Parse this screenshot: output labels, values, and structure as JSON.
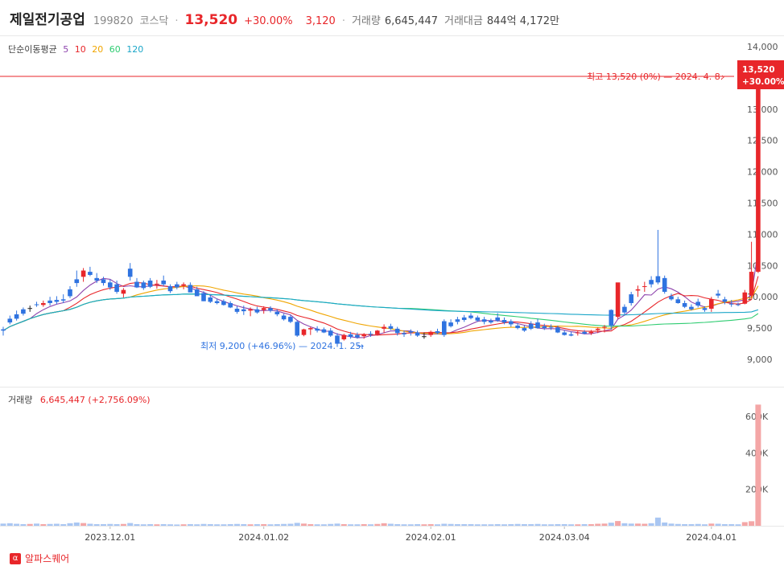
{
  "header": {
    "name": "제일전기공업",
    "code": "199820",
    "market": "코스닥",
    "price": "13,520",
    "change_pct": "+30.00%",
    "change_abs": "3,120",
    "volume_label": "거래량",
    "volume": "6,645,447",
    "amount_label": "거래대금",
    "amount": "844억 4,172만"
  },
  "legend": {
    "title": "단순이동평균",
    "periods": [
      {
        "label": "5",
        "color": "#8e44ad"
      },
      {
        "label": "10",
        "color": "#e8262a"
      },
      {
        "label": "20",
        "color": "#f0a500"
      },
      {
        "label": "60",
        "color": "#2ecc71"
      },
      {
        "label": "120",
        "color": "#1aa6c8"
      }
    ]
  },
  "volume_legend": {
    "label": "거래량",
    "value": "6,645,447",
    "change": "(+2,756.09%)"
  },
  "annotations": {
    "high": "최고 13,520 (0%) — 2024. 4. 8.",
    "low": "최저 9,200 (+46.96%) — 2024. 1. 25.",
    "price_box_price": "13,520",
    "price_box_pct": "+30.00%"
  },
  "footer": {
    "brand": "알파스퀘어",
    "logo_char": "α"
  },
  "colors": {
    "up": "#e8262a",
    "down": "#2f73e0",
    "flat": "#222222",
    "vol_up": "#f4a6a6",
    "vol_down": "#a9c6f2"
  },
  "chart_data": {
    "type": "candlestick",
    "price_axis": {
      "min": 8600,
      "max": 14200,
      "ticks": [
        "14,000",
        "13,500",
        "13,000",
        "12,500",
        "12,000",
        "11,500",
        "11,000",
        "10,500",
        "10,000",
        "9,500",
        "9,000"
      ],
      "tick_values": [
        14000,
        13500,
        13000,
        12500,
        12000,
        11500,
        11000,
        10500,
        10000,
        9500,
        9000
      ]
    },
    "volume_axis": {
      "min": 0,
      "max": 700000,
      "ticks": [
        "600K",
        "400K",
        "200K"
      ],
      "tick_values": [
        600000,
        400000,
        200000
      ]
    },
    "x_ticks": [
      "2023.12.01",
      "2024.01.02",
      "2024.02.01",
      "2024.03.04",
      "2024.04.01"
    ],
    "x_tick_index": [
      16,
      39,
      64,
      84,
      106
    ],
    "candles": [
      [
        9480,
        9520,
        9380,
        9460
      ],
      [
        9650,
        9700,
        9560,
        9590
      ],
      [
        9720,
        9780,
        9620,
        9650
      ],
      [
        9800,
        9830,
        9700,
        9730
      ],
      [
        9820,
        9860,
        9760,
        9820
      ],
      [
        9880,
        9920,
        9840,
        9870
      ],
      [
        9870,
        9940,
        9840,
        9900
      ],
      [
        9940,
        10000,
        9860,
        9900
      ],
      [
        9950,
        10010,
        9880,
        9920
      ],
      [
        9960,
        10040,
        9900,
        9940
      ],
      [
        10120,
        10170,
        9980,
        10010
      ],
      [
        10280,
        10420,
        10160,
        10220
      ],
      [
        10320,
        10460,
        10240,
        10420
      ],
      [
        10400,
        10480,
        10330,
        10350
      ],
      [
        10300,
        10380,
        10220,
        10260
      ],
      [
        10280,
        10320,
        10180,
        10220
      ],
      [
        10230,
        10280,
        10110,
        10150
      ],
      [
        10200,
        10260,
        10050,
        10080
      ],
      [
        10050,
        10140,
        9990,
        10110
      ],
      [
        10450,
        10540,
        10260,
        10320
      ],
      [
        10240,
        10300,
        10140,
        10150
      ],
      [
        10230,
        10260,
        10110,
        10140
      ],
      [
        10260,
        10300,
        10140,
        10160
      ],
      [
        10200,
        10270,
        10130,
        10210
      ],
      [
        10260,
        10340,
        10170,
        10200
      ],
      [
        10170,
        10200,
        10060,
        10090
      ],
      [
        10200,
        10240,
        10120,
        10150
      ],
      [
        10180,
        10230,
        10120,
        10200
      ],
      [
        10190,
        10230,
        10080,
        10070
      ],
      [
        10120,
        10160,
        10020,
        10010
      ],
      [
        10060,
        10090,
        9930,
        9930
      ],
      [
        9990,
        10040,
        9900,
        9920
      ],
      [
        9930,
        9970,
        9880,
        9900
      ],
      [
        9930,
        9960,
        9860,
        9870
      ],
      [
        9900,
        9930,
        9820,
        9830
      ],
      [
        9810,
        9850,
        9730,
        9760
      ],
      [
        9800,
        9860,
        9710,
        9770
      ],
      [
        9780,
        9830,
        9690,
        9800
      ],
      [
        9800,
        9840,
        9730,
        9750
      ],
      [
        9790,
        9850,
        9730,
        9820
      ],
      [
        9820,
        9850,
        9750,
        9780
      ],
      [
        9760,
        9800,
        9690,
        9720
      ],
      [
        9700,
        9730,
        9620,
        9640
      ],
      [
        9680,
        9710,
        9580,
        9600
      ],
      [
        9600,
        9620,
        9360,
        9380
      ],
      [
        9390,
        9490,
        9370,
        9480
      ],
      [
        9480,
        9520,
        9390,
        9500
      ],
      [
        9490,
        9530,
        9430,
        9460
      ],
      [
        9480,
        9510,
        9420,
        9430
      ],
      [
        9460,
        9500,
        9360,
        9380
      ],
      [
        9380,
        9420,
        9200,
        9250
      ],
      [
        9320,
        9410,
        9300,
        9390
      ],
      [
        9400,
        9440,
        9330,
        9360
      ],
      [
        9390,
        9430,
        9330,
        9350
      ],
      [
        9370,
        9420,
        9330,
        9400
      ],
      [
        9410,
        9450,
        9360,
        9400
      ],
      [
        9400,
        9470,
        9380,
        9460
      ],
      [
        9490,
        9560,
        9420,
        9520
      ],
      [
        9530,
        9570,
        9470,
        9490
      ],
      [
        9490,
        9520,
        9380,
        9420
      ],
      [
        9420,
        9460,
        9360,
        9400
      ],
      [
        9450,
        9480,
        9380,
        9430
      ],
      [
        9430,
        9460,
        9360,
        9380
      ],
      [
        9370,
        9430,
        9330,
        9370
      ],
      [
        9390,
        9460,
        9360,
        9440
      ],
      [
        9450,
        9490,
        9400,
        9420
      ],
      [
        9610,
        9640,
        9360,
        9390
      ],
      [
        9590,
        9640,
        9510,
        9530
      ],
      [
        9640,
        9680,
        9560,
        9600
      ],
      [
        9670,
        9710,
        9600,
        9630
      ],
      [
        9700,
        9740,
        9640,
        9660
      ],
      [
        9670,
        9700,
        9600,
        9620
      ],
      [
        9640,
        9680,
        9560,
        9600
      ],
      [
        9620,
        9650,
        9570,
        9590
      ],
      [
        9670,
        9740,
        9600,
        9620
      ],
      [
        9630,
        9670,
        9560,
        9590
      ],
      [
        9610,
        9640,
        9520,
        9560
      ],
      [
        9540,
        9580,
        9480,
        9500
      ],
      [
        9500,
        9540,
        9440,
        9460
      ],
      [
        9570,
        9610,
        9470,
        9490
      ],
      [
        9590,
        9650,
        9490,
        9500
      ],
      [
        9530,
        9570,
        9470,
        9500
      ],
      [
        9520,
        9560,
        9470,
        9510
      ],
      [
        9510,
        9540,
        9420,
        9430
      ],
      [
        9430,
        9460,
        9380,
        9390
      ],
      [
        9400,
        9440,
        9370,
        9380
      ],
      [
        9420,
        9460,
        9380,
        9430
      ],
      [
        9440,
        9470,
        9400,
        9410
      ],
      [
        9420,
        9470,
        9390,
        9440
      ],
      [
        9470,
        9510,
        9420,
        9490
      ],
      [
        9510,
        9550,
        9430,
        9520
      ],
      [
        9790,
        9800,
        9480,
        9540
      ],
      [
        9680,
        10200,
        9650,
        10230
      ],
      [
        9840,
        9880,
        9700,
        9750
      ],
      [
        10040,
        10080,
        9860,
        9900
      ],
      [
        10100,
        10180,
        10000,
        10120
      ],
      [
        10160,
        10240,
        10080,
        10170
      ],
      [
        10270,
        10330,
        10150,
        10200
      ],
      [
        10330,
        11070,
        10200,
        10230
      ],
      [
        10300,
        10340,
        10050,
        10080
      ],
      [
        10010,
        10050,
        9940,
        9960
      ],
      [
        9960,
        10000,
        9890,
        9900
      ],
      [
        9900,
        9940,
        9820,
        9840
      ],
      [
        9840,
        9880,
        9780,
        9800
      ],
      [
        9920,
        9970,
        9830,
        9860
      ],
      [
        9820,
        9850,
        9760,
        9790
      ],
      [
        9810,
        10000,
        9760,
        9960
      ],
      [
        10050,
        10110,
        9980,
        10020
      ],
      [
        9960,
        10000,
        9880,
        9920
      ],
      [
        9890,
        9950,
        9840,
        9880
      ],
      [
        9880,
        9910,
        9850,
        9870
      ],
      [
        9890,
        10110,
        9880,
        10070
      ],
      [
        10020,
        10880,
        9990,
        10400
      ],
      [
        10400,
        13520,
        10380,
        13520
      ]
    ],
    "volumes": [
      12000,
      14000,
      11000,
      9000,
      10000,
      12000,
      9000,
      10000,
      11000,
      9000,
      14000,
      18000,
      15000,
      11000,
      9000,
      9000,
      10000,
      9000,
      10000,
      15000,
      9000,
      8000,
      9000,
      8000,
      9000,
      8000,
      7000,
      8000,
      9000,
      8000,
      10000,
      9000,
      8000,
      8000,
      9000,
      10000,
      9000,
      8000,
      9000,
      9000,
      8000,
      9000,
      10000,
      11000,
      16000,
      12000,
      9000,
      8000,
      8000,
      10000,
      12000,
      9000,
      8000,
      8000,
      9000,
      8000,
      10000,
      14000,
      11000,
      9000,
      8000,
      8000,
      9000,
      8000,
      9000,
      8000,
      11000,
      10000,
      9000,
      9000,
      9000,
      8000,
      8000,
      8000,
      9000,
      8000,
      9000,
      10000,
      9000,
      9000,
      10000,
      8000,
      8000,
      9000,
      9000,
      8000,
      8000,
      9000,
      9000,
      11000,
      12000,
      17000,
      26000,
      14000,
      12000,
      12000,
      11000,
      14000,
      45000,
      18000,
      12000,
      10000,
      9000,
      9000,
      10000,
      8000,
      12000,
      11000,
      9000,
      9000,
      8000,
      20000,
      25000,
      665000
    ]
  }
}
